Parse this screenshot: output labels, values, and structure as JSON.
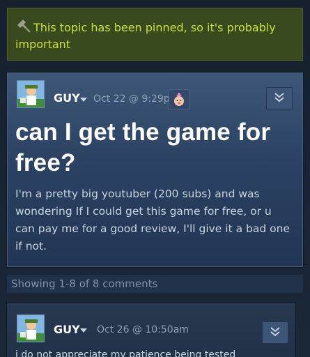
{
  "pinned_notice": {
    "text": "This topic has been pinned, so it's probably important",
    "icon": "pin-icon"
  },
  "topic": {
    "author": "GUY",
    "date": "Oct 22 @ 9:29pm",
    "title": "can I get the game for free?",
    "body": "I'm a pretty big youtuber (200 subs) and was wondering If I could get this game for free, or u can pay me for a good review, I'll give it a bad one if not."
  },
  "comments_summary": "Showing 1-8 of 8 comments",
  "comments": [
    {
      "author": "GUY",
      "date": "Oct 26 @ 10:50am",
      "body": "i do not appreciate my patience being tested"
    }
  ],
  "colors": {
    "pinned_text": "#c6e13b",
    "pinned_background": "#3a4a1f",
    "page_background": "#1b2838"
  }
}
